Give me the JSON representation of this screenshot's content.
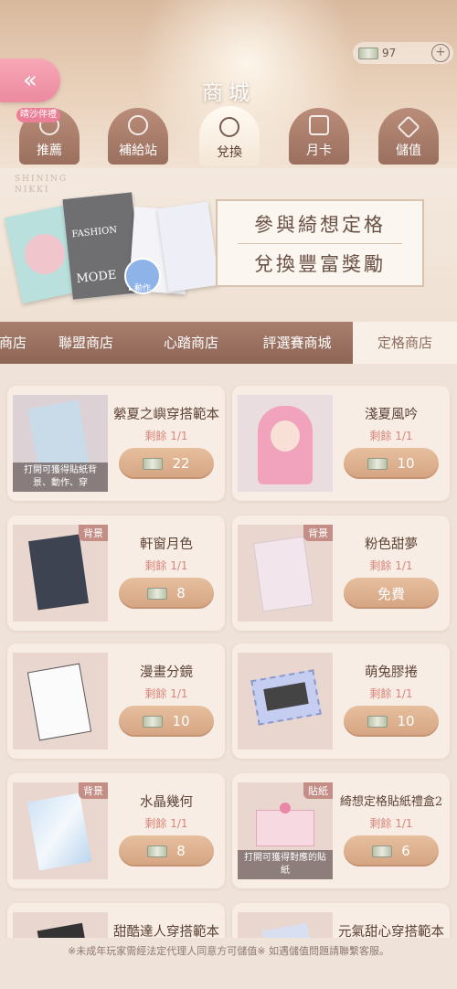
{
  "header": {
    "title": "商城",
    "currency_amount": "97",
    "back_icon": "double-chevron-left-icon",
    "plus_icon": "plus-icon"
  },
  "badge": "晴沙伴禮",
  "tabs": [
    {
      "label": "推薦",
      "icon": "flower-icon"
    },
    {
      "label": "補給站",
      "icon": "clock-icon"
    },
    {
      "label": "兌換",
      "icon": "exchange-icon",
      "active": true
    },
    {
      "label": "月卡",
      "icon": "calendar-icon"
    },
    {
      "label": "儲值",
      "icon": "diamond-icon"
    }
  ],
  "banner": {
    "brand_line1": "SHINING",
    "brand_line2": "NIKKI",
    "line1": "參與綺想定格",
    "line2": "兌換豐富獎勵",
    "mag_text1": "FASHION",
    "mag_text2": "MODE",
    "action_label": "動作"
  },
  "subtabs": [
    "商店",
    "聯盟商店",
    "心踏商店",
    "評選賽商城",
    "定格商店"
  ],
  "items": [
    {
      "name": "縈夏之嶼穿搭範本",
      "remain": "剩餘 1/1",
      "price": "22",
      "hint": "打開可獲得貼紙背景、動作、穿",
      "tag": ""
    },
    {
      "name": "淺夏風吟",
      "remain": "剩餘 1/1",
      "price": "10",
      "hint": "",
      "tag": ""
    },
    {
      "name": "軒窗月色",
      "remain": "剩餘 1/1",
      "price": "8",
      "hint": "",
      "tag": "背景"
    },
    {
      "name": "粉色甜夢",
      "remain": "剩餘 1/1",
      "price": "免費",
      "hint": "",
      "tag": "背景"
    },
    {
      "name": "漫畫分鏡",
      "remain": "剩餘 1/1",
      "price": "10",
      "hint": "",
      "tag": ""
    },
    {
      "name": "萌兔膠捲",
      "remain": "剩餘 1/1",
      "price": "10",
      "hint": "",
      "tag": ""
    },
    {
      "name": "水晶幾何",
      "remain": "剩餘 1/1",
      "price": "8",
      "hint": "",
      "tag": "背景"
    },
    {
      "name": "綺想定格貼紙禮盒2",
      "remain": "剩餘 1/1",
      "price": "6",
      "hint": "打開可獲得對應的貼紙",
      "tag": "貼紙"
    },
    {
      "name": "甜酷達人穿搭範本",
      "remain": "",
      "price": "",
      "hint": "",
      "tag": ""
    },
    {
      "name": "元氣甜心穿搭範本",
      "remain": "",
      "price": "",
      "hint": "",
      "tag": ""
    }
  ],
  "footer": "※未成年玩家需經法定代理人同意方可儲值※ 如遇儲值問題請聯繫客服。"
}
